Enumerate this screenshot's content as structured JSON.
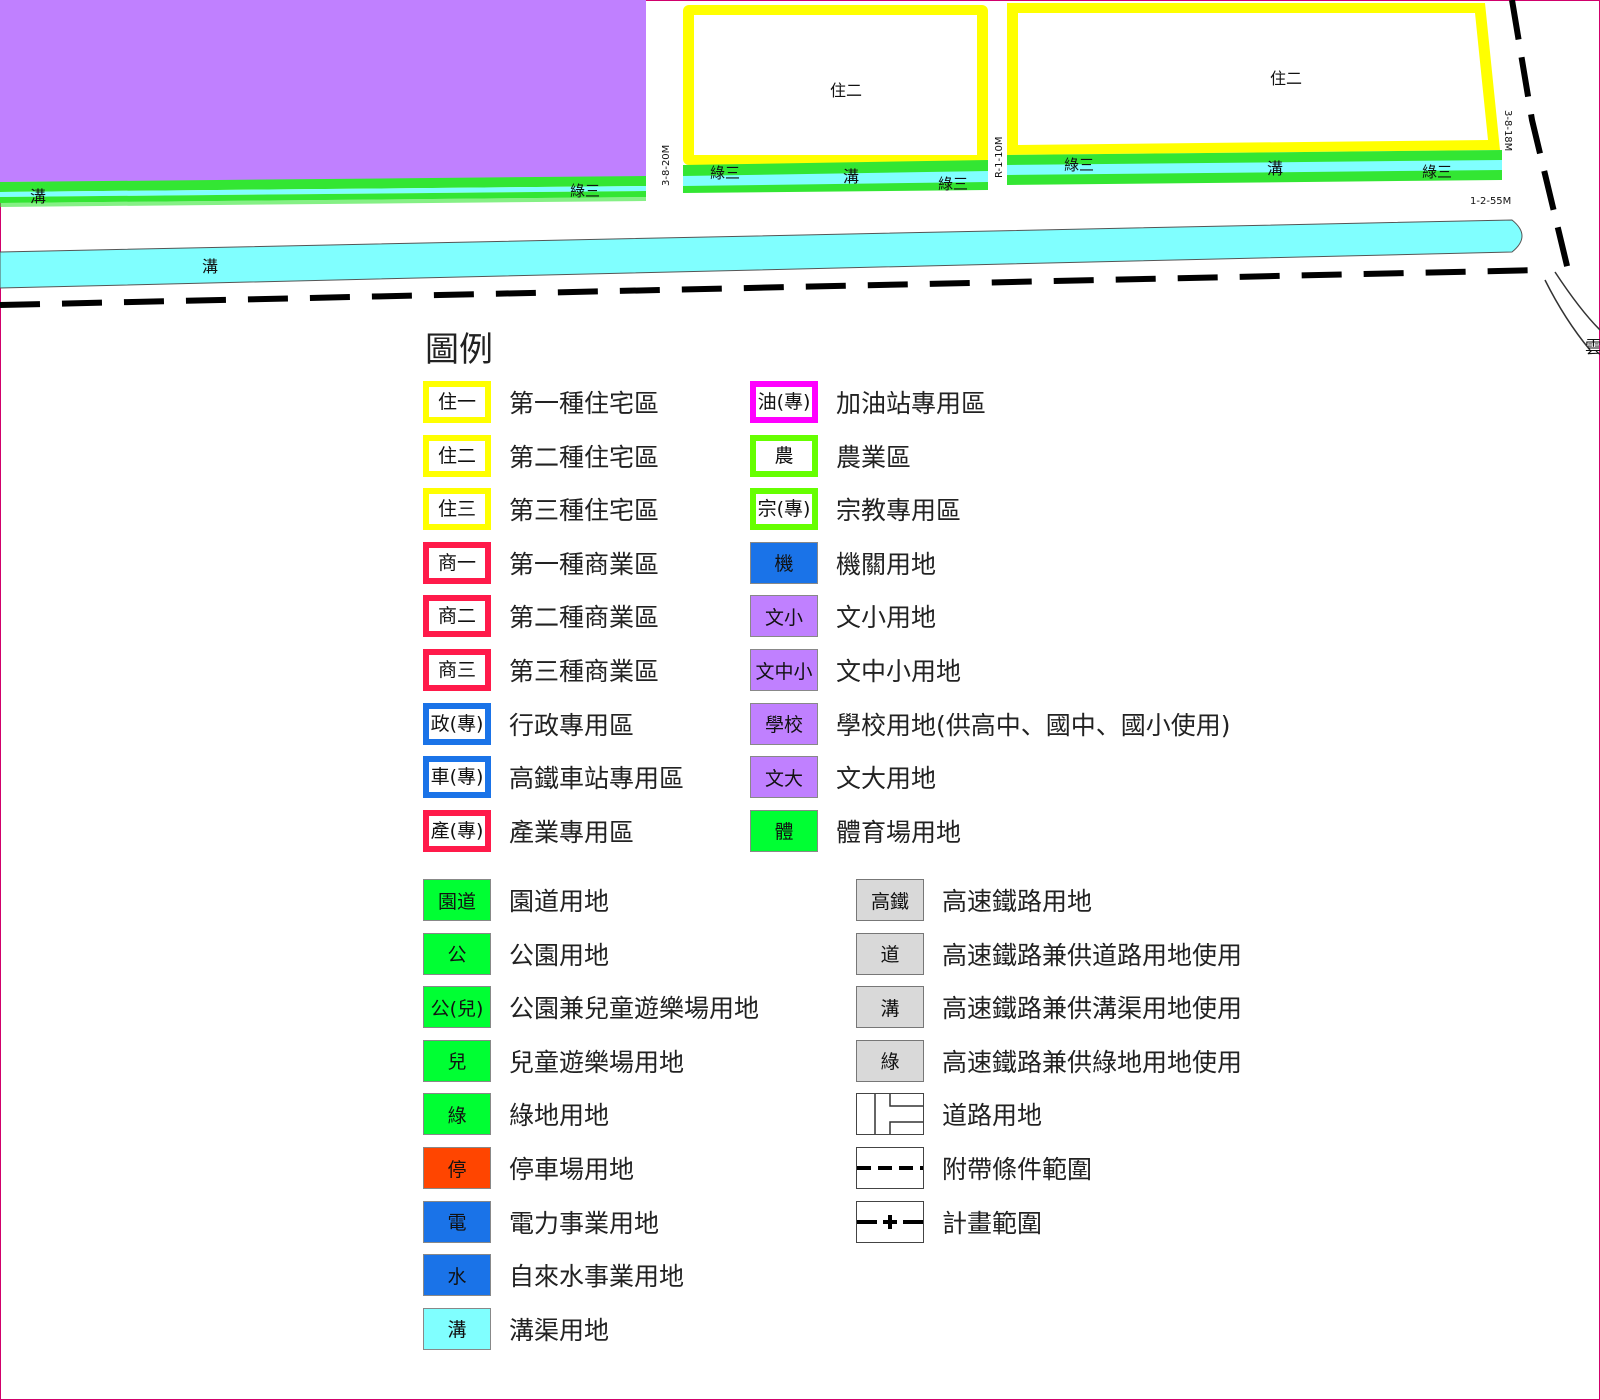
{
  "map": {
    "zone_labels": [
      "住二",
      "住二"
    ],
    "canal_labels": [
      "溝",
      "溝",
      "溝",
      "溝"
    ],
    "green_labels": [
      "綠三",
      "綠三",
      "綠三",
      "綠三",
      "綠三"
    ],
    "road_labels": [
      "3-8-20M",
      "R-1-10M",
      "3-8-18M",
      "1-2-55M"
    ],
    "edge_label": "雲"
  },
  "legend": {
    "title": "圖例",
    "col1": [
      {
        "code": "住一",
        "label": "第一種住宅區",
        "color": "#ffff00",
        "style": "frame"
      },
      {
        "code": "住二",
        "label": "第二種住宅區",
        "color": "#ffff00",
        "style": "frame"
      },
      {
        "code": "住三",
        "label": "第三種住宅區",
        "color": "#ffff00",
        "style": "frame"
      },
      {
        "code": "商一",
        "label": "第一種商業區",
        "color": "#ff1a4a",
        "style": "frame"
      },
      {
        "code": "商二",
        "label": "第二種商業區",
        "color": "#ff1a4a",
        "style": "frame"
      },
      {
        "code": "商三",
        "label": "第三種商業區",
        "color": "#ff1a4a",
        "style": "frame"
      },
      {
        "code": "政(專)",
        "label": "行政專用區",
        "color": "#1a73e8",
        "style": "frame"
      },
      {
        "code": "車(專)",
        "label": "高鐵車站專用區",
        "color": "#1a73e8",
        "style": "frame"
      },
      {
        "code": "產(專)",
        "label": "產業專用區",
        "color": "#ff1a4a",
        "style": "frame"
      }
    ],
    "col2": [
      {
        "code": "油(專)",
        "label": "加油站專用區",
        "color": "#ff00ff",
        "style": "frame"
      },
      {
        "code": "農",
        "label": "農業區",
        "color": "#66ff00",
        "style": "frame"
      },
      {
        "code": "宗(專)",
        "label": "宗教專用區",
        "color": "#66ff00",
        "style": "frame"
      },
      {
        "code": "機",
        "label": "機關用地",
        "color": "#1a73e8",
        "style": "fill"
      },
      {
        "code": "文小",
        "label": "文小用地",
        "color": "#c080ff",
        "style": "fill"
      },
      {
        "code": "文中小",
        "label": "文中小用地",
        "color": "#c080ff",
        "style": "fill"
      },
      {
        "code": "學校",
        "label": "學校用地(供高中、國中、國小使用)",
        "color": "#c080ff",
        "style": "fill"
      },
      {
        "code": "文大",
        "label": "文大用地",
        "color": "#c080ff",
        "style": "fill"
      },
      {
        "code": "體",
        "label": "體育場用地",
        "color": "#00ff33",
        "style": "fill"
      }
    ],
    "col3": [
      {
        "code": "園道",
        "label": "園道用地",
        "color": "#00ff33",
        "style": "fill"
      },
      {
        "code": "公",
        "label": "公園用地",
        "color": "#00ff33",
        "style": "fill"
      },
      {
        "code": "公(兒)",
        "label": "公園兼兒童遊樂場用地",
        "color": "#00ff33",
        "style": "fill"
      },
      {
        "code": "兒",
        "label": "兒童遊樂場用地",
        "color": "#00ff33",
        "style": "fill"
      },
      {
        "code": "綠",
        "label": "綠地用地",
        "color": "#00ff33",
        "style": "fill"
      },
      {
        "code": "停",
        "label": "停車場用地",
        "color": "#ff4500",
        "style": "fill"
      },
      {
        "code": "電",
        "label": "電力事業用地",
        "color": "#1a73e8",
        "style": "fill"
      },
      {
        "code": "水",
        "label": "自來水事業用地",
        "color": "#1a73e8",
        "style": "fill"
      },
      {
        "code": "溝",
        "label": "溝渠用地",
        "color": "#80ffff",
        "style": "fill"
      }
    ],
    "col4": [
      {
        "code": "高鐵",
        "label": "高速鐵路用地",
        "color": "#d9d9d9",
        "style": "grey"
      },
      {
        "code": "道",
        "label": "高速鐵路兼供道路用地使用",
        "color": "#d9d9d9",
        "style": "grey"
      },
      {
        "code": "溝",
        "label": "高速鐵路兼供溝渠用地使用",
        "color": "#d9d9d9",
        "style": "grey"
      },
      {
        "code": "綠",
        "label": "高速鐵路兼供綠地用地使用",
        "color": "#d9d9d9",
        "style": "grey"
      },
      {
        "code": "",
        "label": "道路用地",
        "color": "#ffffff",
        "style": "road"
      },
      {
        "code": "",
        "label": "附帶條件範圍",
        "color": "#ffffff",
        "style": "dash"
      },
      {
        "code": "",
        "label": "計畫範圍",
        "color": "#ffffff",
        "style": "plan"
      }
    ]
  }
}
